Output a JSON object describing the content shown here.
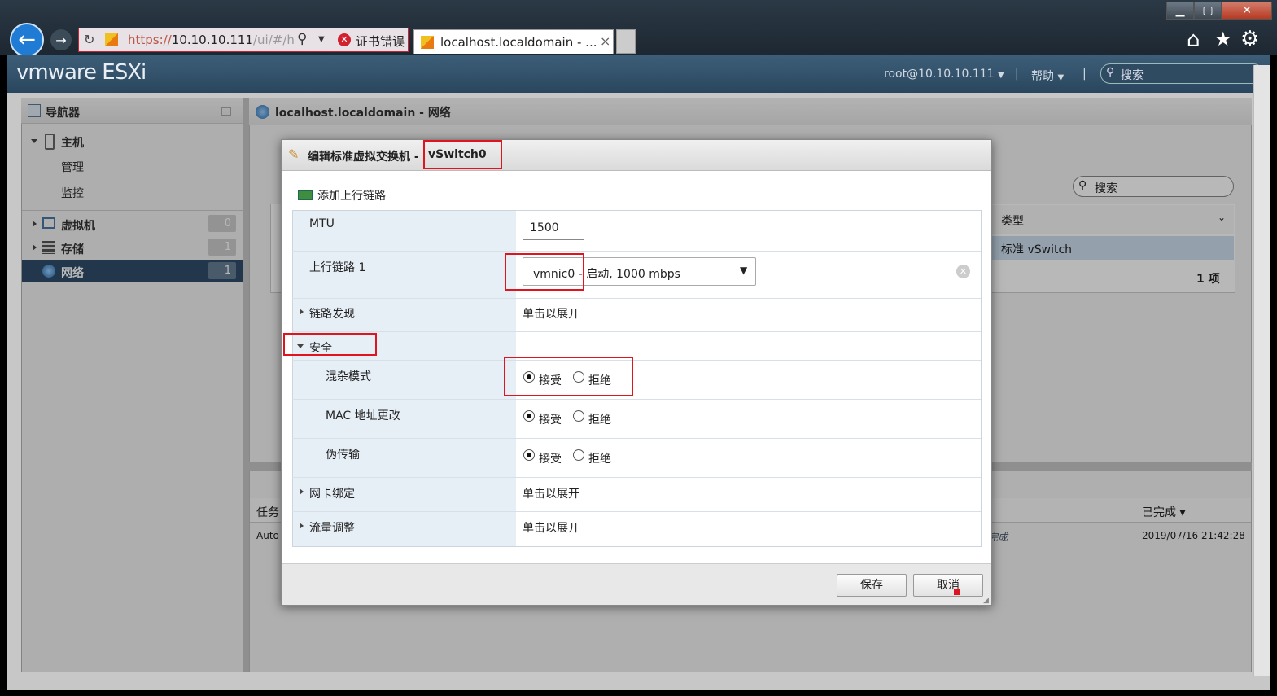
{
  "browser": {
    "address_prefix": "https://",
    "address_host": "10.10.10.111",
    "address_path": "/ui/#/h",
    "cert_error": "证书错误",
    "tab_title": "localhost.localdomain - ...",
    "tab_close": "×"
  },
  "esxi": {
    "logo": "vmware ESXi",
    "user": "root@10.10.10.111",
    "help": "帮助",
    "search_placeholder": "搜索"
  },
  "navigator": {
    "title": "导航器",
    "host": "主机",
    "manage": "管理",
    "monitor": "监控",
    "items": [
      {
        "label": "虚拟机",
        "count": "0"
      },
      {
        "label": "存储",
        "count": "1"
      },
      {
        "label": "网络",
        "count": "1"
      }
    ]
  },
  "main": {
    "title": "localhost.localdomain - 网络",
    "search": "搜索",
    "col_type": "类型",
    "row_type": "标准 vSwitch",
    "count": "1 项"
  },
  "tasks": {
    "col_task": "任务",
    "col_done": "已完成 ▾",
    "row_task": "Auto",
    "row_done": "2019/07/16 21:42:28",
    "row_status": "完成"
  },
  "modal": {
    "title": "编辑标准虚拟交换机 - ",
    "switch_name": "vSwitch0",
    "add_uplink": "添加上行链路",
    "mtu_label": "MTU",
    "mtu_value": "1500",
    "uplink_label": "上行链路 1",
    "uplink_value": "vmnic0 - 启动, 1000 mbps",
    "link_discovery": "链路发现",
    "expand_hint": "单击以展开",
    "security": "安全",
    "promisc": "混杂模式",
    "mac_change": "MAC 地址更改",
    "forged": "伪传输",
    "accept": "接受",
    "reject": "拒绝",
    "nic_teaming": "网卡绑定",
    "traffic_shaping": "流量调整",
    "save": "保存",
    "cancel": "取消"
  }
}
